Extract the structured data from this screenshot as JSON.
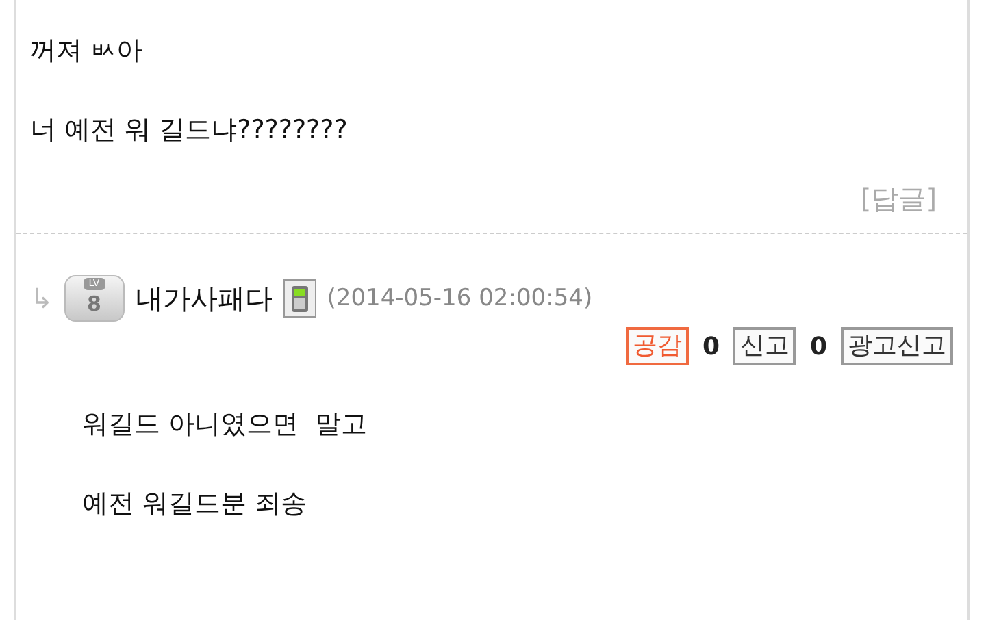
{
  "comment": {
    "lines": [
      "꺼져 ㅄ아",
      "너 예전 워 길드냐????????"
    ],
    "reply_link": "[답글]"
  },
  "reply": {
    "arrow": "↳",
    "level_badge": {
      "label": "LV",
      "number": "8"
    },
    "author": "내가사패다",
    "timestamp": "(2014-05-16 02:00:54)",
    "actions": [
      {
        "label": "공감",
        "highlighted": true,
        "count": "0"
      },
      {
        "label": "신고",
        "highlighted": false,
        "count": "0"
      },
      {
        "label": "광고신고",
        "highlighted": false
      }
    ],
    "lines": [
      "워길드 아니였으면  말고",
      "예전 워길드분 죄송"
    ]
  }
}
